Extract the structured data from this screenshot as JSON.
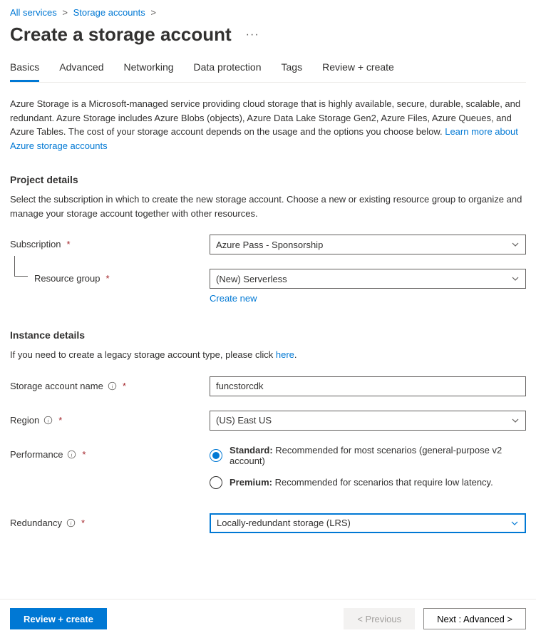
{
  "breadcrumb": {
    "items": [
      "All services",
      "Storage accounts"
    ]
  },
  "page_title": "Create a storage account",
  "tabs": [
    "Basics",
    "Advanced",
    "Networking",
    "Data protection",
    "Tags",
    "Review + create"
  ],
  "active_tab_index": 0,
  "intro": {
    "text": "Azure Storage is a Microsoft-managed service providing cloud storage that is highly available, secure, durable, scalable, and redundant. Azure Storage includes Azure Blobs (objects), Azure Data Lake Storage Gen2, Azure Files, Azure Queues, and Azure Tables. The cost of your storage account depends on the usage and the options you choose below. ",
    "link": "Learn more about Azure storage accounts"
  },
  "project": {
    "title": "Project details",
    "desc": "Select the subscription in which to create the new storage account. Choose a new or existing resource group to organize and manage your storage account together with other resources.",
    "subscription_label": "Subscription",
    "subscription_value": "Azure Pass - Sponsorship",
    "rg_label": "Resource group",
    "rg_value": "(New) Serverless",
    "create_new": "Create new"
  },
  "instance": {
    "title": "Instance details",
    "legacy_text": "If you need to create a legacy storage account type, please click ",
    "legacy_link": "here",
    "name_label": "Storage account name",
    "name_value": "funcstorcdk",
    "region_label": "Region",
    "region_value": "(US) East US",
    "perf_label": "Performance",
    "perf_options": [
      {
        "title": "Standard:",
        "desc": " Recommended for most scenarios (general-purpose v2 account)",
        "checked": true
      },
      {
        "title": "Premium:",
        "desc": " Recommended for scenarios that require low latency.",
        "checked": false
      }
    ],
    "redundancy_label": "Redundancy",
    "redundancy_value": "Locally-redundant storage (LRS)"
  },
  "footer": {
    "review": "Review + create",
    "previous": "< Previous",
    "next": "Next : Advanced >"
  }
}
